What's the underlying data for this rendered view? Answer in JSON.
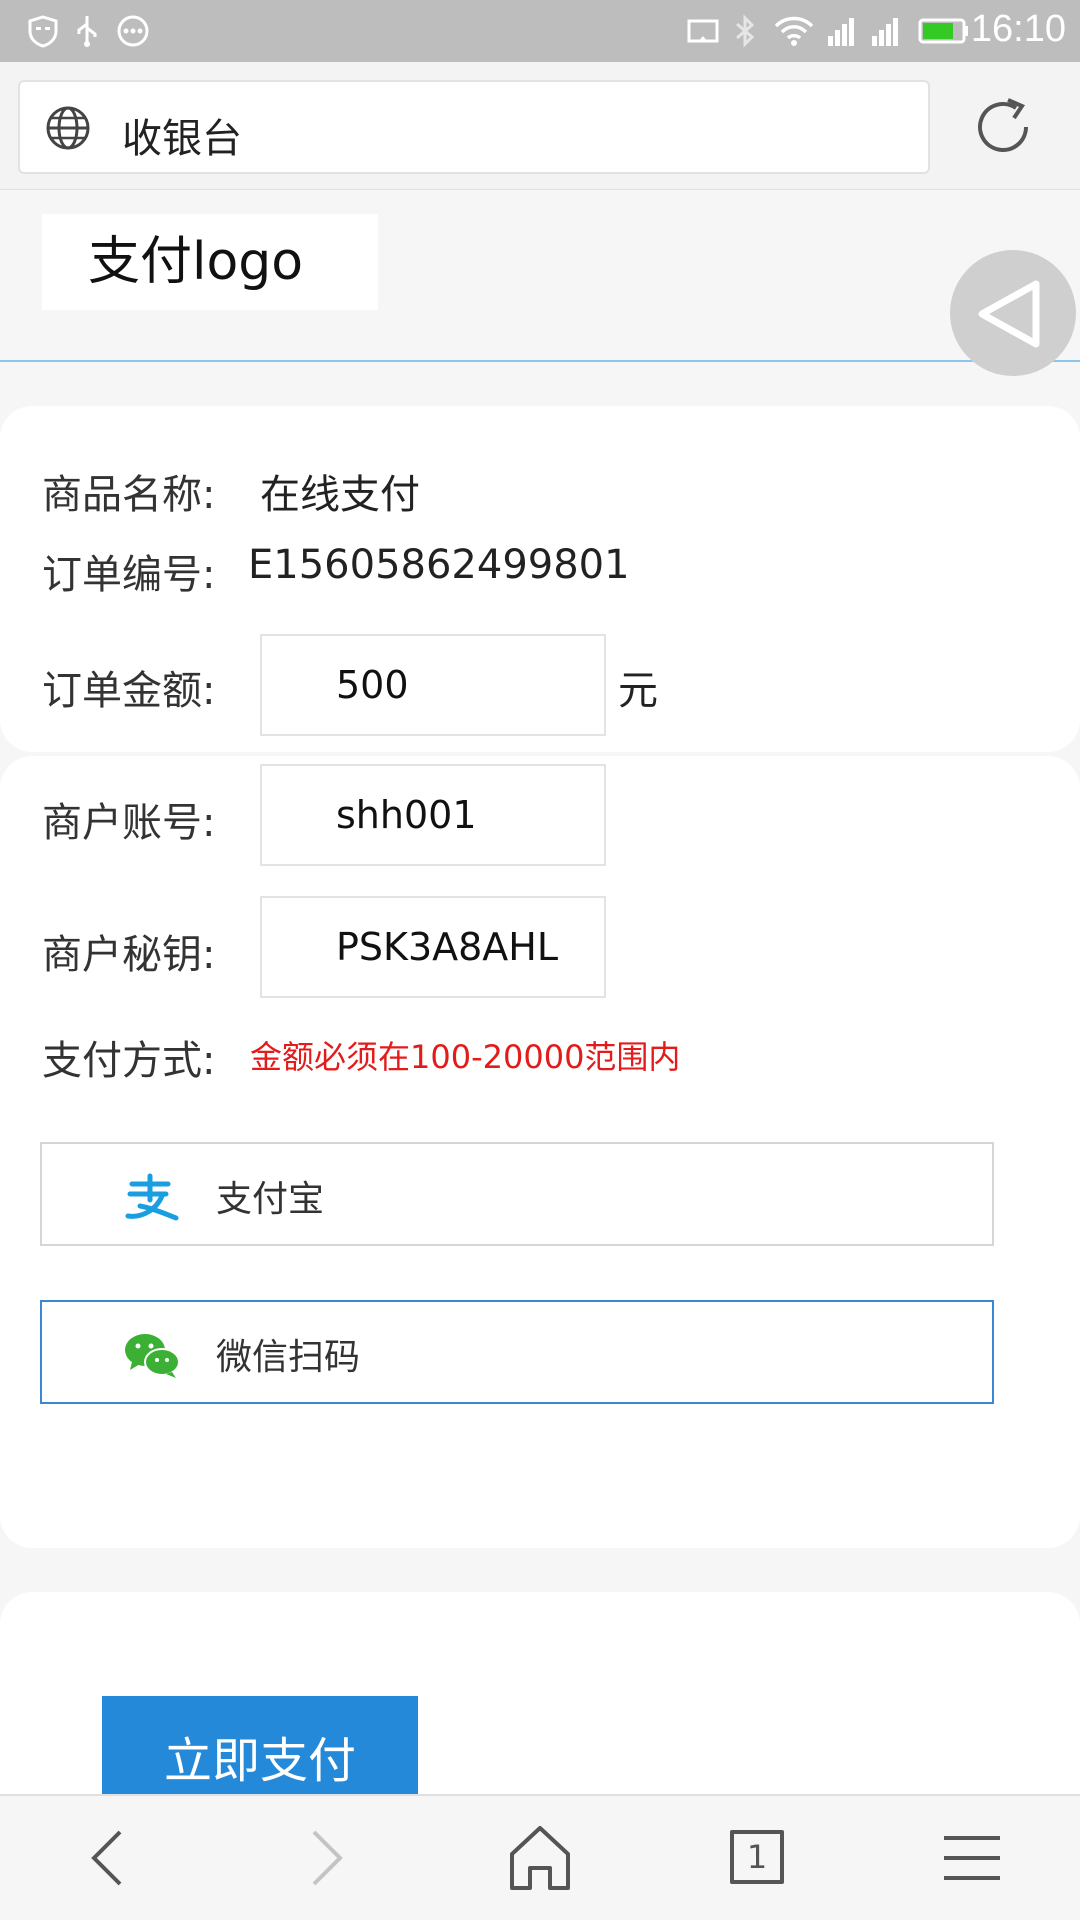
{
  "status_bar": {
    "time": "16:10",
    "icons": [
      "shield-icon",
      "usb-icon",
      "more-icon",
      "cast-icon",
      "bluetooth-icon",
      "wifi-icon",
      "signal-icon",
      "signal-icon-2",
      "battery-icon"
    ],
    "battery_color": "#34c924"
  },
  "browser": {
    "page_title": "收银台",
    "icons": [
      "globe-icon",
      "reload-icon"
    ]
  },
  "header": {
    "logo_text": "支付logo"
  },
  "order": {
    "product_label": "商品名称:",
    "product_value": "在线支付",
    "order_no_label": "订单编号:",
    "order_no_value": "E15605862499801",
    "amount_label": "订单金额:",
    "amount_value": "500",
    "amount_unit": "元"
  },
  "merchant": {
    "account_label": "商户账号:",
    "account_value": "shh001",
    "secret_label": "商户秘钥:",
    "secret_value": "PSK3A8AHL",
    "pay_method_label": "支付方式:",
    "warning": "金额必须在100-20000范围内"
  },
  "payment_options": [
    {
      "label": "支付宝",
      "icon": "alipay-icon",
      "selected": false
    },
    {
      "label": "微信扫码",
      "icon": "wechat-icon",
      "selected": true
    }
  ],
  "submit_label": "立即支付",
  "bottom_nav": {
    "tab_count": "1",
    "icons": [
      "back-icon",
      "forward-icon",
      "home-icon",
      "tabs-icon",
      "menu-icon"
    ]
  },
  "colors": {
    "accent": "#2589da",
    "warning": "#e31b1b",
    "alipay": "#1a9ee2",
    "wechat": "#3cb034"
  }
}
